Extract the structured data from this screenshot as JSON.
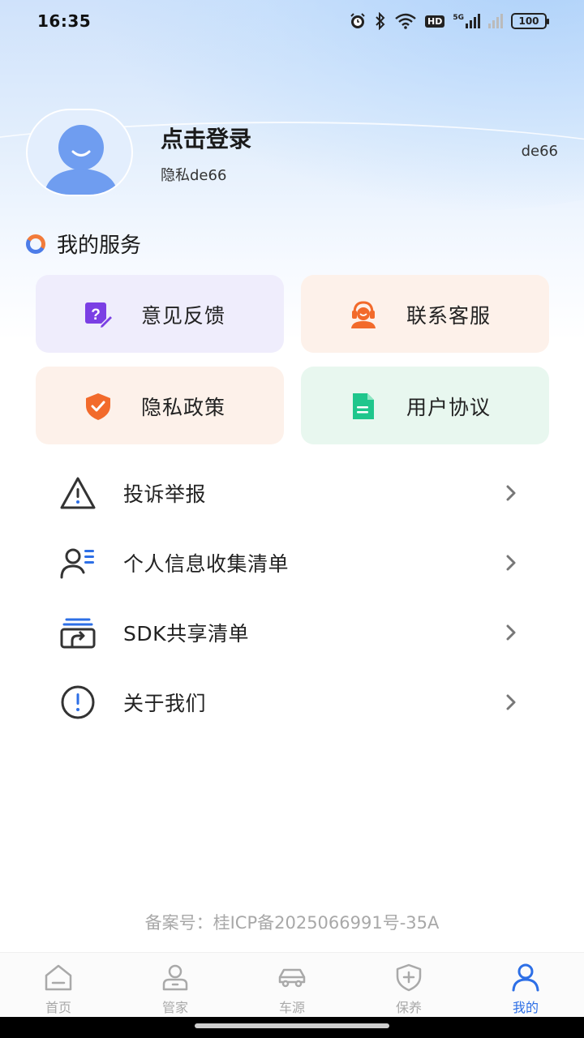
{
  "status_bar": {
    "time": "16:35",
    "icons": [
      "alarm-icon",
      "bluetooth-icon",
      "wifi-icon",
      "hd-icon",
      "signal-5g-icon",
      "signal-icon"
    ],
    "hd_label": "HD",
    "net_label": "5G",
    "battery": "100"
  },
  "profile": {
    "login_title": "点击登录",
    "subtitle": "隐私de66",
    "right_tag": "de66",
    "avatar_icon": "user-avatar-icon"
  },
  "services": {
    "title": "我的服务",
    "cards": [
      {
        "label": "意见反馈",
        "icon": "feedback-icon",
        "color": "#7b3fe4"
      },
      {
        "label": "联系客服",
        "icon": "customer-service-icon",
        "color": "#f26a2b"
      },
      {
        "label": "隐私政策",
        "icon": "shield-icon",
        "color": "#f26a2b"
      },
      {
        "label": "用户协议",
        "icon": "document-icon",
        "color": "#1fc68c"
      }
    ]
  },
  "menu": {
    "items": [
      {
        "label": "投诉举报",
        "icon": "warning-icon"
      },
      {
        "label": "个人信息收集清单",
        "icon": "user-list-icon"
      },
      {
        "label": "SDK共享清单",
        "icon": "share-icon"
      },
      {
        "label": "关于我们",
        "icon": "info-icon"
      }
    ]
  },
  "footer": {
    "icp": "备案号：桂ICP备2025066991号-35A"
  },
  "tab_bar": {
    "tabs": [
      {
        "label": "首页",
        "icon": "home-icon"
      },
      {
        "label": "管家",
        "icon": "butler-icon"
      },
      {
        "label": "车源",
        "icon": "car-icon"
      },
      {
        "label": "保养",
        "icon": "maintenance-icon"
      },
      {
        "label": "我的",
        "icon": "profile-icon",
        "active": true
      }
    ],
    "active_color": "#2d6fe6",
    "inactive_color": "#a9a9a9"
  }
}
